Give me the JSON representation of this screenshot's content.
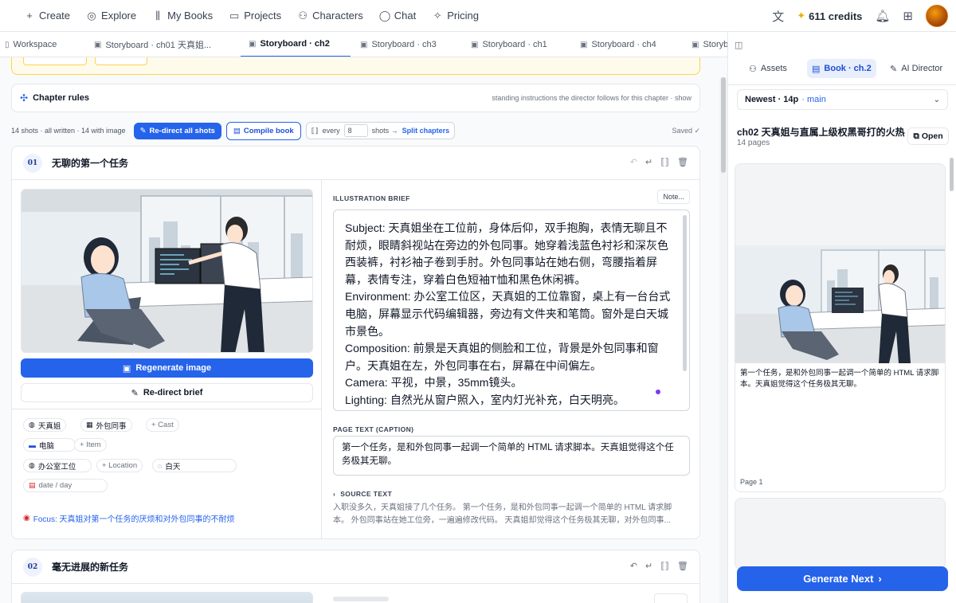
{
  "nav": {
    "items": [
      {
        "icon": "plus-icon",
        "glyph": "+",
        "label": "Create"
      },
      {
        "icon": "globe-icon",
        "glyph": "◎",
        "label": "Explore"
      },
      {
        "icon": "books-icon",
        "glyph": "⫼",
        "label": "My Books"
      },
      {
        "icon": "folder-icon",
        "glyph": "▭",
        "label": "Projects"
      },
      {
        "icon": "users-icon",
        "glyph": "⚇",
        "label": "Characters"
      },
      {
        "icon": "chat-icon",
        "glyph": "◯",
        "label": "Chat"
      },
      {
        "icon": "sparkle-icon",
        "glyph": "✧",
        "label": "Pricing"
      }
    ],
    "credits": "611 credits"
  },
  "tabs": [
    {
      "label": "Workspace",
      "active": false
    },
    {
      "label": "Storyboard · ch01 天真姐...",
      "active": false
    },
    {
      "label": "Storyboard · ch2",
      "active": true
    },
    {
      "label": "Storyboard · ch3",
      "active": false
    },
    {
      "label": "Storyboard · ch1",
      "active": false
    },
    {
      "label": "Storyboard · ch4",
      "active": false
    },
    {
      "label": "Storyb",
      "active": false
    }
  ],
  "rules": {
    "title": "Chapter rules",
    "hint": "standing instructions the director follows for this chapter · show"
  },
  "toolbar": {
    "stats": "14 shots · all written · 14 with image",
    "redirect_all": "Re-direct all shots",
    "compile": "Compile book",
    "every": "every",
    "every_value": "8",
    "shots_arrow": "shots →",
    "split": "Split chapters",
    "saved": "Saved ✓"
  },
  "shot1": {
    "number": "01",
    "title": "无聊的第一个任务",
    "regenerate": "Regenerate image",
    "redirect": "Re-direct brief",
    "cast": [
      {
        "name": "天真姐"
      },
      {
        "name": "外包同事"
      }
    ],
    "add_cast": "+ Cast",
    "item": "电脑",
    "add_item": "+ Item",
    "location": "办公室工位",
    "add_location": "+ Location",
    "time": "白天",
    "date_placeholder": "date / day",
    "focus": "Focus: 天真姐对第一个任务的厌烦和对外包同事的不耐烦",
    "brief_label": "ILLUSTRATION BRIEF",
    "note_btn": "Note...",
    "brief": "Subject: 天真姐坐在工位前，身体后仰，双手抱胸，表情无聊且不耐烦，眼睛斜视站在旁边的外包同事。她穿着浅蓝色衬衫和深灰色西装裤，衬衫袖子卷到手肘。外包同事站在她右侧，弯腰指着屏幕，表情专注，穿着白色短袖T恤和黑色休闲裤。\nEnvironment: 办公室工位区，天真姐的工位靠窗，桌上有一台台式电脑，屏幕显示代码编辑器，旁边有文件夹和笔筒。窗外是白天城市景色。\nComposition: 前景是天真姐的侧脸和工位，背景是外包同事和窗户。天真姐在左，外包同事在右，屏幕在中间偏左。\nCamera: 平视，中景，35mm镜头。\nLighting: 自然光从窗户照入，室内灯光补充，白天明亮。",
    "caption_label": "PAGE TEXT (CAPTION)",
    "caption": "第一个任务，是和外包同事一起调一个简单的 HTML 请求脚本。天真姐觉得这个任务极其无聊。",
    "source_label": "SOURCE TEXT",
    "source": "入职没多久，天真姐接了几个任务。 第一个任务，是和外包同事一起调一个简单的 HTML 请求脚本。 外包同事站在她工位旁，一遍遍修改代码。 天真姐却觉得这个任务极其无聊，对外包同事..."
  },
  "shot2": {
    "number": "02",
    "title": "毫无进展的新任务"
  },
  "right_panel": {
    "tabs": [
      {
        "label": "Assets",
        "active": false
      },
      {
        "label": "Book · ch.2",
        "active": true
      },
      {
        "label": "AI Director",
        "active": false
      }
    ],
    "version": "Newest · 14p",
    "branch": "· main",
    "book_title": "ch02 天真姐与直属上级权黑哥打的火热",
    "pages": "14 pages",
    "open": "Open",
    "page_caption": "第一个任务，是和外包同事一起调一个简单的 HTML 请求脚本。天真姐觉得这个任务极其无聊。",
    "page_no": "Page 1",
    "generate_next": "Generate Next"
  },
  "colors": {
    "accent": "#2563eb",
    "warning_border": "#fcd34d",
    "warning_bg": "#fffbeb"
  }
}
